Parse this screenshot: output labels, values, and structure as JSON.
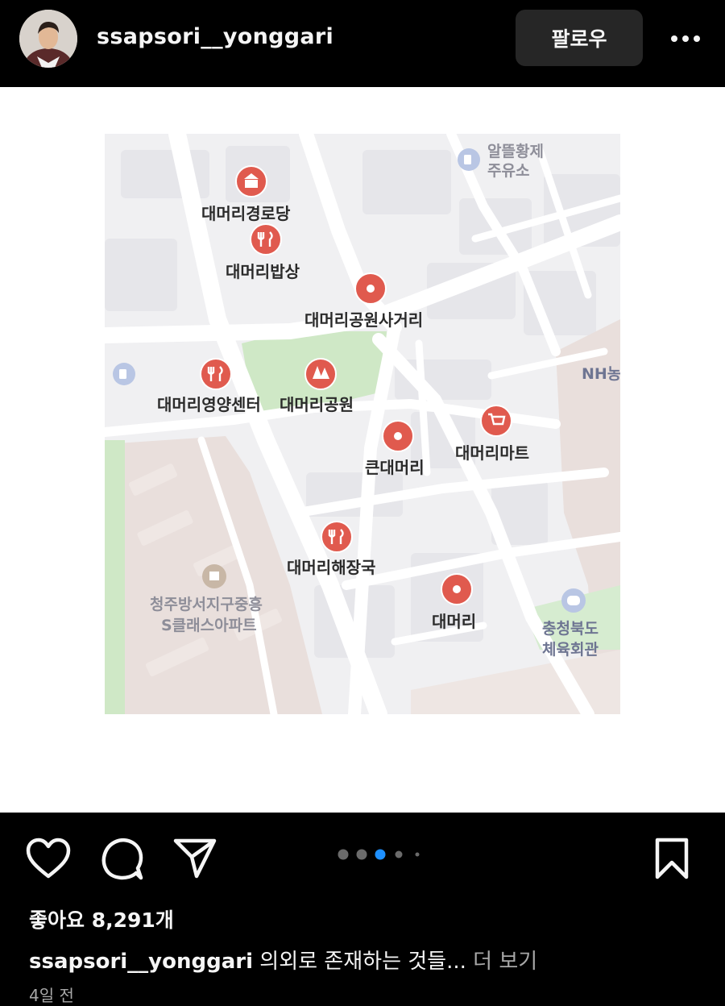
{
  "header": {
    "username": "ssapsori__yonggari",
    "follow_label": "팔로우"
  },
  "map": {
    "places": [
      {
        "label": "대머리경로당",
        "icon": "building-icon"
      },
      {
        "label": "대머리밥상",
        "icon": "restaurant-icon"
      },
      {
        "label": "대머리공원사거리",
        "icon": "location-icon"
      },
      {
        "label": "대머리영양센터",
        "icon": "restaurant-icon"
      },
      {
        "label": "대머리공원",
        "icon": "park-icon"
      },
      {
        "label": "큰대머리",
        "icon": "location-icon"
      },
      {
        "label": "대머리마트",
        "icon": "cart-icon"
      },
      {
        "label": "대머리해장국",
        "icon": "restaurant-icon"
      },
      {
        "label": "대머리",
        "icon": "location-icon"
      }
    ],
    "gray_labels": {
      "gas_station_1": "알뜰황제",
      "gas_station_2": "주유소",
      "bank": "NH농",
      "apartment_1": "청주방서지구중흥",
      "apartment_2": "S클래스아파트",
      "gym_1": "충청북도",
      "gym_2": "체육회관"
    },
    "colors": {
      "marker": "#e05a4e",
      "background": "#f0f0f2",
      "park": "#cfe8c6",
      "apartment": "#e9dfdc"
    }
  },
  "carousel": {
    "count": 5,
    "active_index": 2
  },
  "likes_text": "좋아요 8,291개",
  "caption": {
    "username": "ssapsori__yonggari",
    "text": "의외로 존재하는 것들...",
    "more_label": "더 보기"
  },
  "time_text": "4일 전"
}
